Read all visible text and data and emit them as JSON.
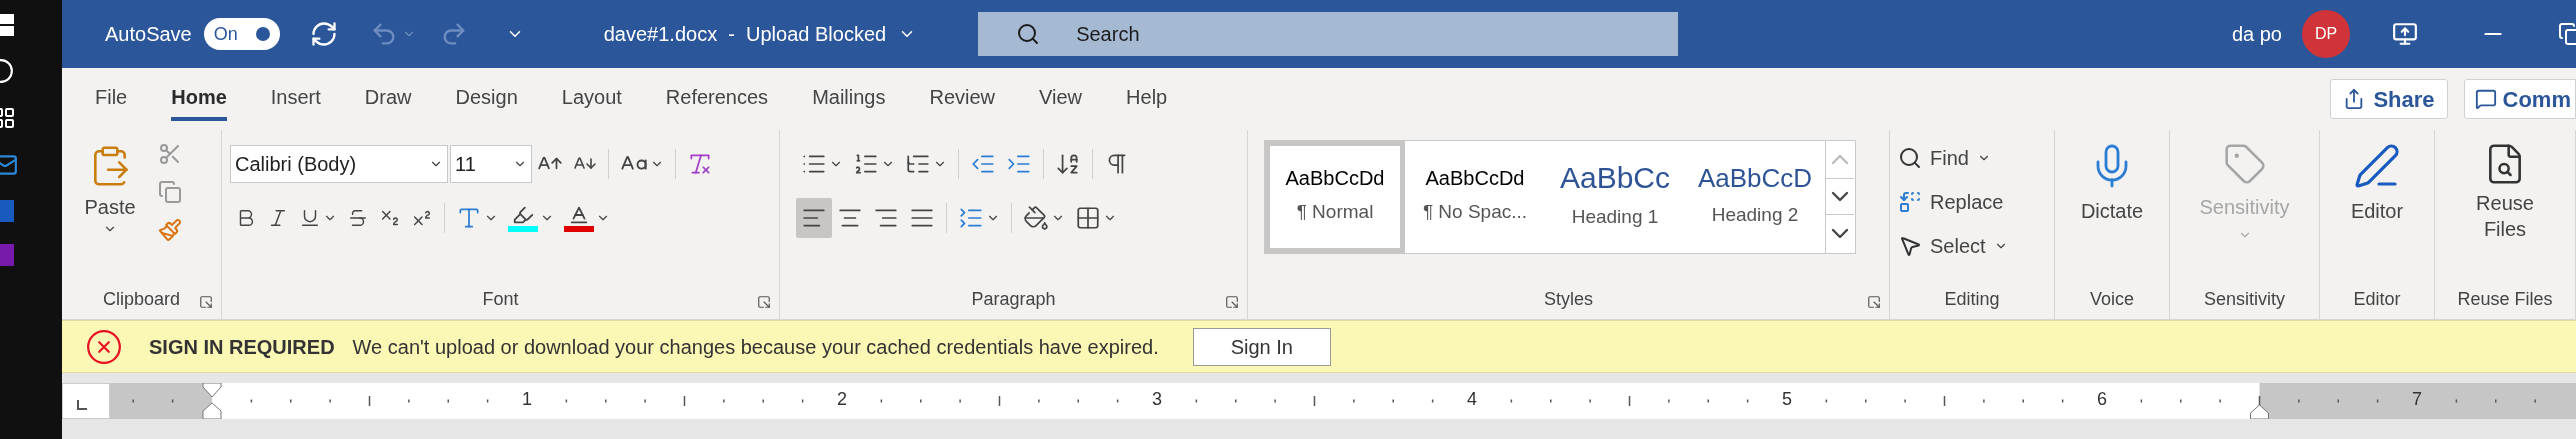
{
  "title_bar": {
    "autosave_label": "AutoSave",
    "autosave": {
      "label": "On",
      "on": true
    },
    "undo_disabled": true,
    "redo_disabled": true,
    "document_title": "dave#1.docx  -  Upload Blocked",
    "search": {
      "placeholder": "Search"
    },
    "user_name": "da po",
    "avatar_initials": "DP"
  },
  "tabs": [
    {
      "label": "File",
      "selected": false
    },
    {
      "label": "Home",
      "selected": true
    },
    {
      "label": "Insert",
      "selected": false
    },
    {
      "label": "Draw",
      "selected": false
    },
    {
      "label": "Design",
      "selected": false
    },
    {
      "label": "Layout",
      "selected": false
    },
    {
      "label": "References",
      "selected": false
    },
    {
      "label": "Mailings",
      "selected": false
    },
    {
      "label": "Review",
      "selected": false
    },
    {
      "label": "View",
      "selected": false
    },
    {
      "label": "Help",
      "selected": false
    }
  ],
  "share_button": "Share",
  "comments_button": "Comm",
  "ribbon": {
    "clipboard": {
      "paste": "Paste",
      "label": "Clipboard"
    },
    "font": {
      "font_name": "Calibri (Body)",
      "font_size": "11",
      "label": "Font"
    },
    "paragraph": {
      "alignments": [
        {
          "kind": "left",
          "selected": true
        },
        {
          "kind": "center",
          "selected": false
        },
        {
          "kind": "right",
          "selected": false
        },
        {
          "kind": "justify",
          "selected": false
        }
      ],
      "label": "Paragraph"
    },
    "styles": {
      "items": [
        {
          "kind": "normal",
          "preview": "AaBbCcDd",
          "name": "¶ Normal",
          "selected": true
        },
        {
          "kind": "normal",
          "preview": "AaBbCcDd",
          "name": "¶ No Spac...",
          "selected": false
        },
        {
          "kind": "heading1",
          "preview": "AaBbCc",
          "name": "Heading 1",
          "selected": false
        },
        {
          "kind": "heading2",
          "preview": "AaBbCcD",
          "name": "Heading 2",
          "selected": false
        }
      ],
      "label": "Styles"
    },
    "editing": {
      "items": [
        {
          "kind": "find",
          "label": "Find"
        },
        {
          "kind": "replace",
          "label": "Replace"
        },
        {
          "kind": "select",
          "label": "Select"
        }
      ],
      "label": "Editing"
    },
    "voice": {
      "button": "Dictate",
      "label": "Voice"
    },
    "sensitivity": {
      "button": "Sensitivity",
      "disabled": true,
      "label": "Sensitivity"
    },
    "editor": {
      "button": "Editor",
      "label": "Editor"
    },
    "reuse_files": {
      "button": "Reuse Files",
      "label": "Reuse Files"
    }
  },
  "message_bar": {
    "title": "SIGN IN REQUIRED",
    "message": "We can't upload or download your changes because your cached credentials have expired.",
    "button": "Sign In"
  },
  "ruler": {
    "numbers": [
      "1",
      "2",
      "3",
      "4",
      "5",
      "6",
      "7"
    ]
  }
}
